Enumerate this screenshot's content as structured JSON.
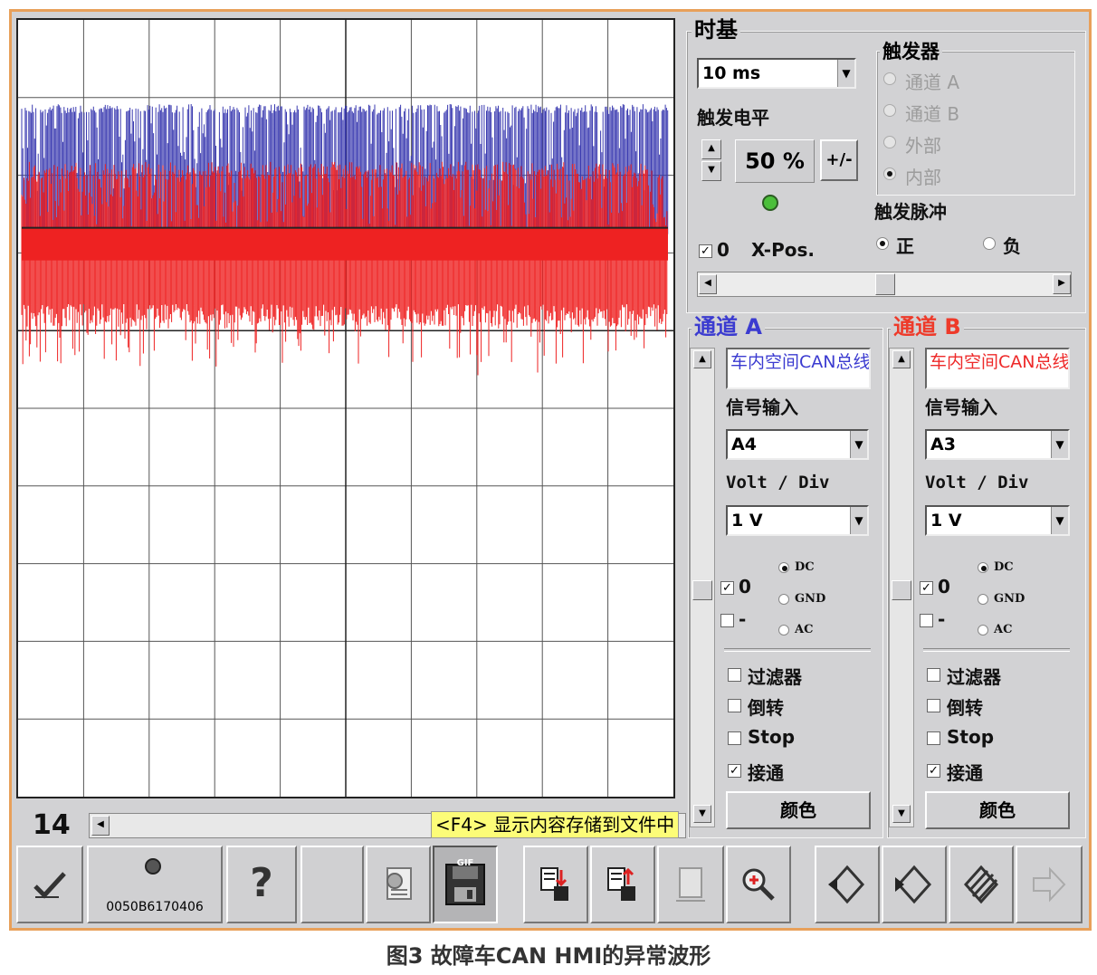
{
  "scope": {
    "channel_a_color": "#3a3ab0",
    "channel_b_color": "#ee2222",
    "grid_color": "#555555"
  },
  "timebase": {
    "title": "时基",
    "value": "10 ms",
    "trigger_level_label": "触发电平",
    "trigger_level_value": "50 %",
    "plus_minus_label": "+/-",
    "xpos_check_label": "0",
    "xpos_label": "X-Pos."
  },
  "trigger": {
    "title": "触发器",
    "options": [
      "通道 A",
      "通道 B",
      "外部",
      "内部"
    ],
    "pulse_title": "触发脉冲",
    "pulse_positive": "正",
    "pulse_negative": "负"
  },
  "channel_a": {
    "title": "通道 A",
    "name": "车内空间CAN总线",
    "input_label": "信号输入",
    "input_value": "A4",
    "vdiv_label": "Volt / Div",
    "vdiv_value": "1 V",
    "zero_label": "0",
    "minus_label": "-",
    "coupling": [
      "DC",
      "GND",
      "AC"
    ],
    "filter_label": "过滤器",
    "invert_label": "倒转",
    "stop_label": "Stop",
    "connect_label": "接通",
    "color_button": "颜色"
  },
  "channel_b": {
    "title": "通道 B",
    "name": "车内空间CAN总线",
    "input_label": "信号输入",
    "input_value": "A3",
    "vdiv_label": "Volt / Div",
    "vdiv_value": "1 V",
    "zero_label": "0",
    "minus_label": "-",
    "coupling": [
      "DC",
      "GND",
      "AC"
    ],
    "filter_label": "过滤器",
    "invert_label": "倒转",
    "stop_label": "Stop",
    "connect_label": "接通",
    "color_button": "颜色"
  },
  "status": {
    "page_number": "14",
    "tooltip": "<F4> 显示内容存储到文件中",
    "device_id": "0050B6170406"
  },
  "toolbar": {
    "help_label": "?",
    "save_label": "GIF"
  },
  "caption": "图3 故障车CAN HMI的异常波形"
}
